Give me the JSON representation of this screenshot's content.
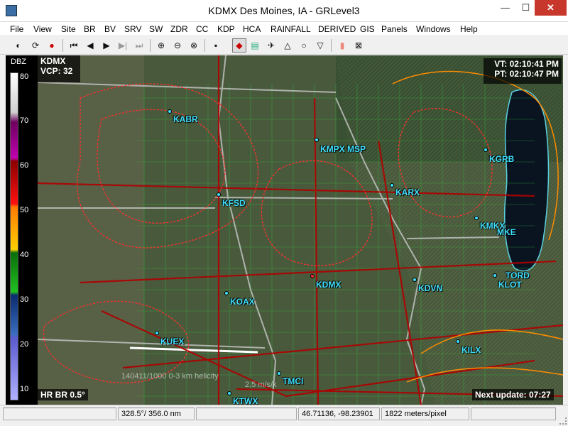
{
  "window": {
    "title": "KDMX Des Moines, IA - GRLevel3",
    "minimize": "—",
    "maximize": "☐",
    "close": "✕"
  },
  "menu": [
    "File",
    "View",
    "Site",
    "BR",
    "BV",
    "SRV",
    "SW",
    "ZDR",
    "CC",
    "KDP",
    "HCA",
    "RAINFALL",
    "DERIVED",
    "GIS",
    "Panels",
    "Windows",
    "Help"
  ],
  "toolbar": {
    "icons": [
      "gr-icon",
      "refresh-icon",
      "alert-icon",
      "first-frame-icon",
      "prev-frame-icon",
      "play-icon",
      "next-frame-icon",
      "last-frame-icon",
      "zoom-in-icon",
      "zoom-out-icon",
      "zoom-fit-icon",
      "stop-icon",
      "color-table-icon",
      "legend-icon",
      "pin-icon",
      "warning-icon",
      "ring-icon",
      "arrow-down-icon",
      "panel-icon",
      "clear-icon"
    ]
  },
  "legend": {
    "title": "DBZ",
    "ticks": [
      "80",
      "70",
      "60",
      "50",
      "40",
      "30",
      "20",
      "10"
    ]
  },
  "map": {
    "site": "KDMX",
    "vcp": "VCP: 32",
    "vt": "VT: 02:10:41 PM",
    "pt": "PT: 02:10:47 PM",
    "product": "HR BR 0.5°",
    "next_update": "Next update: 07:27",
    "overlay_text": "140411/1000 0-3 km helicity",
    "overlay_text2": "2.5 m/s/k",
    "sites": [
      "KABR",
      "KMPX",
      "MSP",
      "KGRB",
      "KARX",
      "KFSD",
      "KMKX",
      "MKE",
      "TORD",
      "KLOT",
      "KDMX",
      "KDVN",
      "KOAX",
      "KUEX",
      "KILX",
      "TMCI",
      "KTWX"
    ]
  },
  "status": {
    "bearing": "328.5°/ 356.0 nm",
    "coords": "46.71136, -98.23901",
    "scale": "1822 meters/pixel"
  },
  "colors": {
    "bg": "#f0f0f0",
    "map": "#4c5b3d",
    "site": "#40e0ff",
    "close": "#c7372c"
  }
}
